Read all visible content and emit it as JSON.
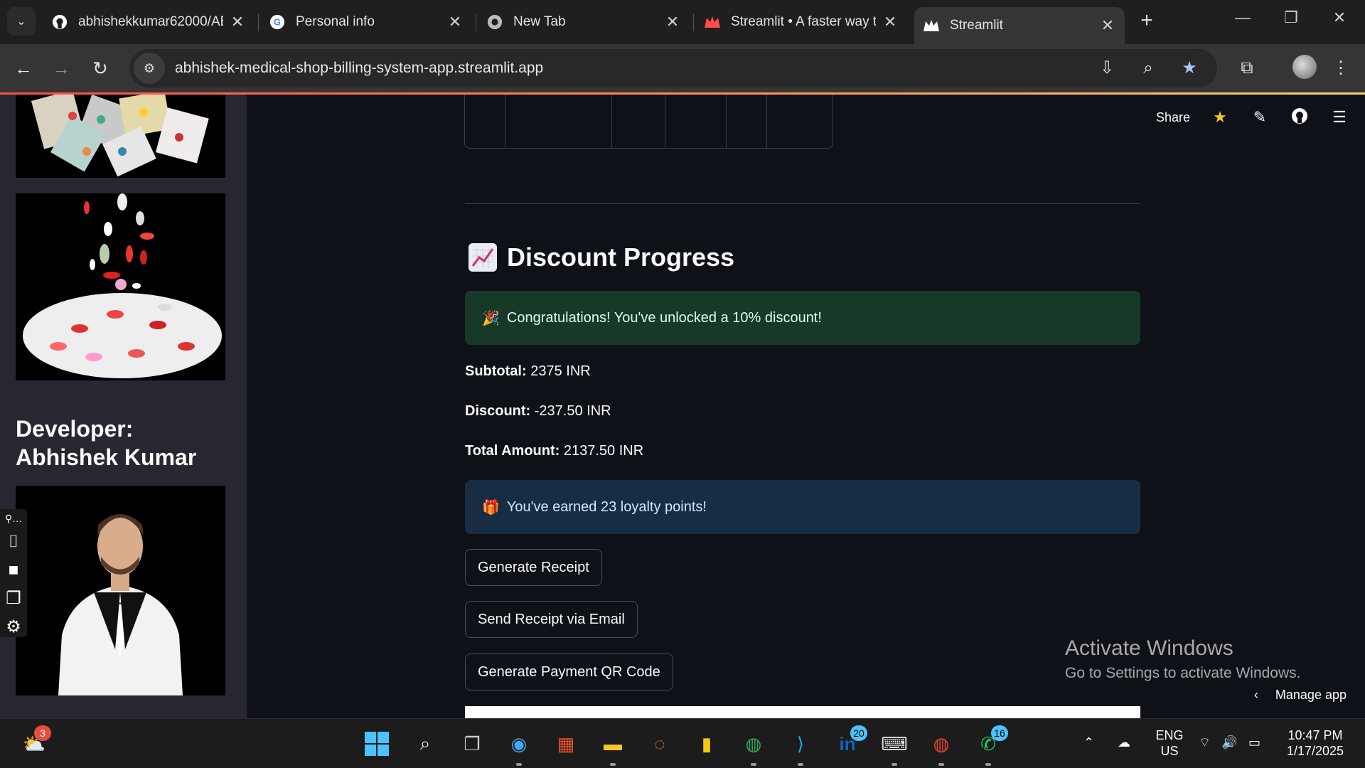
{
  "browser": {
    "tabs": [
      {
        "title": "abhishekkumar62000/AB",
        "icon": "github-icon"
      },
      {
        "title": "Personal info",
        "icon": "google-icon"
      },
      {
        "title": "New Tab",
        "icon": "chrome-icon"
      },
      {
        "title": "Streamlit • A faster way t",
        "icon": "streamlit-icon"
      },
      {
        "title": "Streamlit",
        "icon": "streamlit-icon"
      }
    ],
    "url": "abhishek-medical-shop-billing-system-app.streamlit.app"
  },
  "header": {
    "share_label": "Share"
  },
  "sidebar": {
    "developer_title": "Developer: Abhishek Kumar"
  },
  "main": {
    "section_title": "Discount Progress",
    "success_message": "Congratulations! You've unlocked a 10% discount!",
    "subtotal_label": "Subtotal:",
    "subtotal_value": " 2375 INR",
    "discount_label": "Discount:",
    "discount_value": " -237.50 INR",
    "total_label": "Total Amount:",
    "total_value": " 2137.50 INR",
    "loyalty_message": "You've earned 23 loyalty points!",
    "buttons": {
      "generate_receipt": "Generate Receipt",
      "send_email": "Send Receipt via Email",
      "generate_qr": "Generate Payment QR Code"
    }
  },
  "watermark": {
    "title": "Activate Windows",
    "subtitle": "Go to Settings to activate Windows."
  },
  "manage_app_label": "Manage app",
  "taskbar": {
    "weather_badge": "3",
    "linkedin_badge": "20",
    "whatsapp_badge": "16",
    "lang_line1": "ENG",
    "lang_line2": "US",
    "time": "10:47 PM",
    "date": "1/17/2025"
  },
  "colors": {
    "accent": "#ff4b4b",
    "success_bg": "#173928",
    "info_bg": "#172d43"
  }
}
